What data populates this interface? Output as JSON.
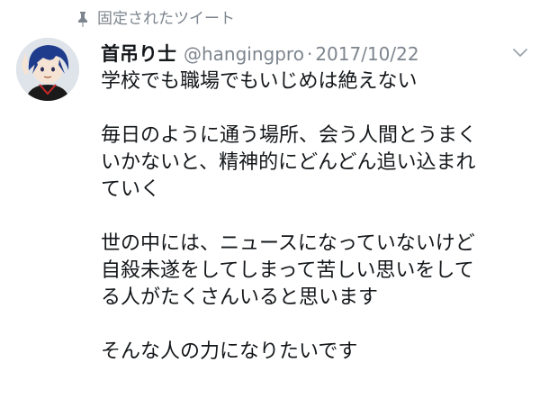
{
  "pinned": {
    "label": "固定されたツイート",
    "icon": "pin-icon"
  },
  "tweet": {
    "display_name": "首吊り士",
    "handle": "@hangingpro",
    "separator": "·",
    "date": "2017/10/22",
    "menu_icon": "chevron-down-icon",
    "paragraphs": [
      [
        "学校でも職場でもいじめは絶えない"
      ],
      [
        "毎日のように通う場所、会う人間とうまく",
        "いかないと、精神的にどんどん追い込まれ",
        "ていく"
      ],
      [
        "世の中には、ニュースになっていないけど",
        "自殺未遂をしてしまって苦しい思いをして",
        "る人がたくさんいると思います"
      ],
      [
        "そんな人の力になりたいです"
      ]
    ]
  },
  "colors": {
    "text": "#14171a",
    "secondary_text": "#7d858e",
    "background": "#ffffff"
  }
}
